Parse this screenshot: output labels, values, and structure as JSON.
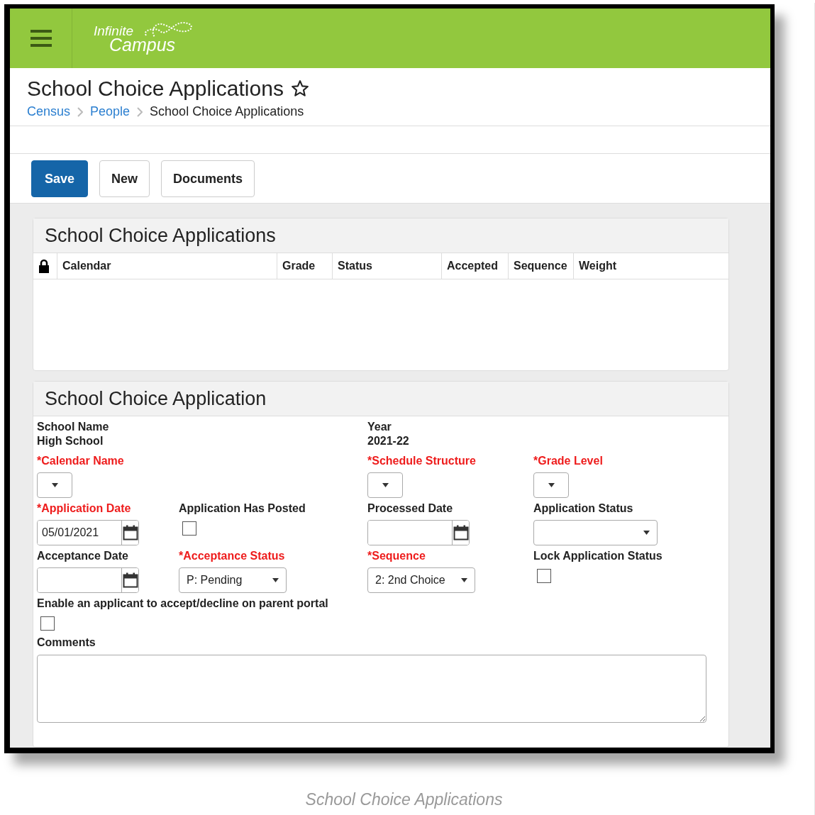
{
  "header": {
    "logo": [
      "Infinite",
      "Campus"
    ]
  },
  "page": {
    "title": "School Choice Applications",
    "favorite": false,
    "breadcrumbs": [
      {
        "label": "Census",
        "link": true
      },
      {
        "label": "People",
        "link": true
      },
      {
        "label": "School Choice Applications",
        "link": false
      }
    ]
  },
  "toolbar": [
    {
      "label": "Save",
      "primary": true
    },
    {
      "label": "New",
      "primary": false
    },
    {
      "label": "Documents",
      "primary": false
    }
  ],
  "list_panel": {
    "title": "School Choice Applications",
    "columns": [
      {
        "kind": "lock"
      },
      {
        "kind": "text",
        "label": "Calendar"
      },
      {
        "kind": "text",
        "label": "Grade"
      },
      {
        "kind": "text",
        "label": "Status"
      },
      {
        "kind": "text",
        "label": "Accepted"
      },
      {
        "kind": "text",
        "label": "Sequence"
      },
      {
        "kind": "text",
        "label": "Weight"
      }
    ]
  },
  "form_panel": {
    "title": "School Choice Application",
    "rows": [
      [
        {
          "kind": "info",
          "label": "School Name",
          "value": "High School"
        },
        null,
        {
          "kind": "info",
          "label": "Year",
          "value": "2021-22"
        },
        null
      ],
      [
        {
          "kind": "mini-select",
          "label": "*Calendar Name",
          "required": true
        },
        null,
        {
          "kind": "mini-select",
          "label": "*Schedule Structure",
          "required": true
        },
        {
          "kind": "mini-select",
          "label": "*Grade Level",
          "required": true
        }
      ],
      [
        {
          "kind": "date",
          "label": "*Application Date",
          "required": true,
          "value": "05/01/2021"
        },
        {
          "kind": "checkbox",
          "label": "Application Has Posted",
          "required": false,
          "checked": false
        },
        {
          "kind": "date",
          "label": "Processed Date",
          "required": false
        },
        {
          "kind": "select",
          "label": "Application Status",
          "required": false
        }
      ],
      [
        {
          "kind": "date",
          "label": "Acceptance Date",
          "required": false
        },
        {
          "kind": "select",
          "label": "*Acceptance Status",
          "required": true,
          "value": "P: Pending"
        },
        {
          "kind": "select",
          "label": "*Sequence",
          "required": true,
          "value": "2: 2nd Choice"
        },
        {
          "kind": "checkbox",
          "label": "Lock Application Status",
          "required": false,
          "checked": false
        }
      ]
    ],
    "portal_option": {
      "label": "Enable an applicant to accept/decline on parent portal",
      "checked": false
    },
    "comments": {
      "label": "Comments"
    }
  },
  "caption": "School Choice Applications"
}
